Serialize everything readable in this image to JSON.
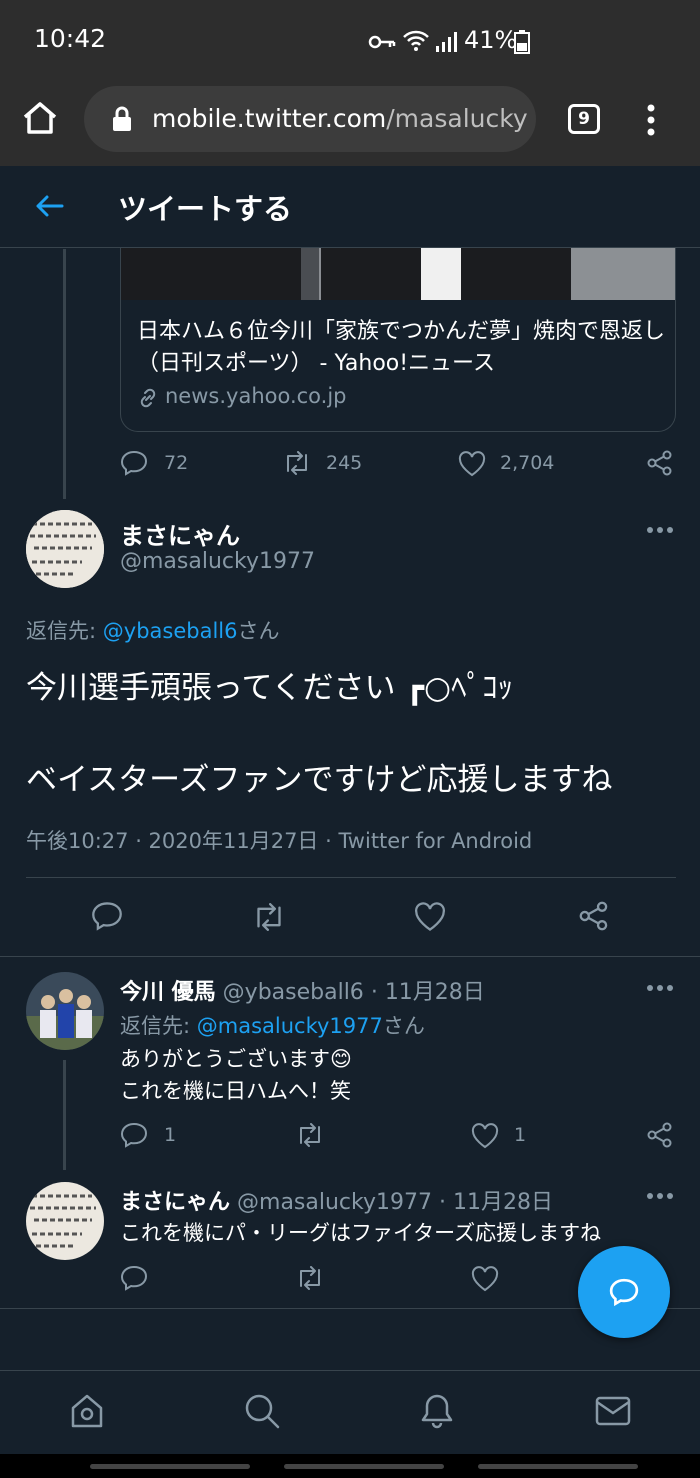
{
  "status_bar": {
    "time": "10:42",
    "battery": "41%",
    "icons": [
      "key-icon",
      "wifi-icon",
      "signal-icon",
      "battery-icon"
    ]
  },
  "browser": {
    "url_domain": "mobile.twitter.com",
    "url_path": "/masalucky",
    "tab_count": "9"
  },
  "header": {
    "title": "ツイートする"
  },
  "link_card": {
    "title": "日本ハム６位今川「家族でつかんだ夢」焼肉で恩返し（日刊スポーツ） - Yahoo!ニュース",
    "domain": "news.yahoo.co.jp"
  },
  "parent_actions": {
    "replies": "72",
    "retweets": "245",
    "likes": "2,704"
  },
  "main_tweet": {
    "display_name": "まさにゃん",
    "handle": "@masalucky1977",
    "reply_label": "返信先:",
    "reply_to": "@ybaseball6",
    "reply_suffix": "さん",
    "line1": "今川選手頑張ってください ┏○ﾍﾟｺｯ",
    "line2": "ベイスターズファンですけど応援しますね",
    "meta": "午後10:27 · 2020年11月27日 · Twitter for Android"
  },
  "reply1": {
    "display_name": "今川 優馬",
    "handle": "@ybaseball6",
    "sep": "·",
    "date": "11月28日",
    "reply_label": "返信先:",
    "reply_to": "@masalucky1977",
    "reply_suffix": "さん",
    "line1": "ありがとうございます",
    "emoji": "😊",
    "line2": "これを機に日ハムへ！笑",
    "replies": "1",
    "likes": "1"
  },
  "reply2": {
    "display_name": "まさにゃん",
    "handle": "@masalucky1977",
    "sep": "·",
    "date": "11月28日",
    "text": "これを機にパ・リーグはファイターズ応援しますね"
  },
  "colors": {
    "background": "#15202b",
    "accent": "#1da1f2",
    "muted": "#8899a6",
    "border": "#38444d"
  }
}
